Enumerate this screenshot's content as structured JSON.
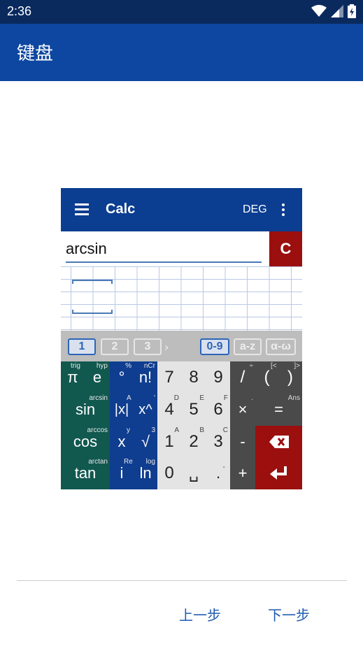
{
  "status_bar": {
    "time": "2:36"
  },
  "app_bar": {
    "title": "键盘"
  },
  "calc": {
    "title": "Calc",
    "angle_mode": "DEG",
    "input_value": "arcsin",
    "clear_label": "C",
    "tabs": [
      "1",
      "2",
      "3",
      "0-9",
      "a-z",
      "α-ω"
    ],
    "tab_arrow": "›",
    "keys": {
      "pi": "π",
      "pi_sup": "trig",
      "e": "e",
      "e_sup": "hyp",
      "deg": "°",
      "deg_sup": "%",
      "fact": "n!",
      "fact_sup": "nCr",
      "k7": "7",
      "k8": "8",
      "k9": "9",
      "div": "/",
      "div_sup": "÷",
      "lparen": "(",
      "lparen_sup": "[<",
      "rparen": ")",
      "rparen_sup": "]>",
      "sin": "sin",
      "sin_sup": "arcsin",
      "abs": "|x|",
      "abs_sup": "A",
      "pow": "x^",
      "pow_sup": "'",
      "k4": "4",
      "k4_sup": "D",
      "k5": "5",
      "k5_sup": "E",
      "k6": "6",
      "k6_sup": "F",
      "mul": "×",
      "mul_sup": ".",
      "eq": "=",
      "eq_sup": "Ans",
      "cos": "cos",
      "cos_sup": "arccos",
      "x": "x",
      "x_sup": "y",
      "sqrt": "√",
      "sqrt_sup": "3",
      "k1": "1",
      "k1_sup": "A",
      "k2": "2",
      "k2_sup": "B",
      "k3": "3",
      "k3_sup": "C",
      "minus": "-",
      "tan": "tan",
      "tan_sup": "arctan",
      "i": "i",
      "i_sup": "Re",
      "ln": "ln",
      "ln_sup": "log",
      "k0": "0",
      "space": "␣",
      "dot": ".",
      "dot_sup": "'",
      "plus": "+"
    }
  },
  "navigation": {
    "prev": "上一步",
    "next": "下一步"
  },
  "colors": {
    "app_bar": "#0d47a1",
    "status_bar": "#0a2a5e",
    "calc_bar": "#0b3d91",
    "clear": "#9b0f0f",
    "teal_key": "#11584f",
    "blue_key": "#0f3d8f"
  }
}
